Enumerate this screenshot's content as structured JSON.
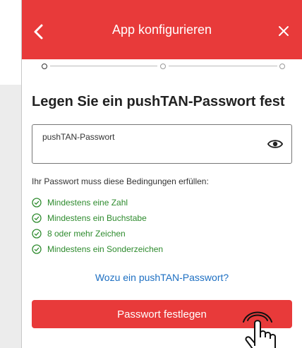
{
  "header": {
    "title": "App konfigurieren",
    "back_icon": "chevron-left-icon",
    "close_icon": "close-icon",
    "background": "#e83a3a"
  },
  "stepper": {
    "current_step": 1,
    "total_steps": 3
  },
  "main": {
    "heading": "Legen Sie ein pushTAN-Passwort fest",
    "password_field": {
      "label": "pushTAN-Passwort",
      "value": "",
      "toggle_icon": "eye-icon"
    },
    "conditions_title": "Ihr Passwort muss diese Bedingungen erfüllen:",
    "conditions": [
      "Mindestens eine Zahl",
      "Mindestens ein Buchstabe",
      "8 oder mehr Zeichen",
      "Mindestens ein Sonderzeichen"
    ],
    "help_link": "Wozu ein pushTAN-Passwort?",
    "submit_button": "Passwort festlegen"
  },
  "colors": {
    "accent": "#e83a3a",
    "success": "#2e8b2e",
    "link": "#1d6fc2"
  }
}
